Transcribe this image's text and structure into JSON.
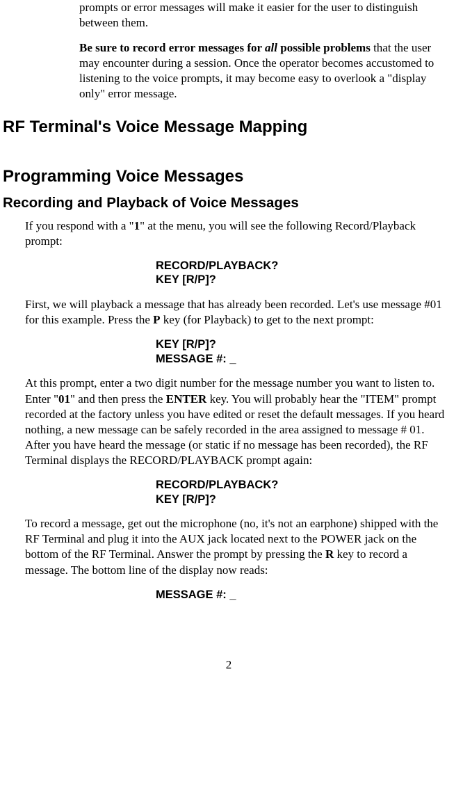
{
  "para1": "prompts or error messages will make it easier for the user to distinguish between them.",
  "para2_start": "Be sure to record error messages for ",
  "para2_all": "all",
  "para2_mid": " possible problems",
  "para2_end": " that the user may encounter during a session. Once the operator becomes accustomed to listening to the voice prompts, it may become easy to overlook a \"display only\" error message.",
  "h1a": "RF Terminal's Voice Message Mapping",
  "h1b": "Programming Voice Messages",
  "h2a": "Recording and Playback of Voice Messages",
  "para3_start": "If you respond with a \"",
  "para3_one": "1",
  "para3_end": "\" at the menu, you will see the following Record/Playback prompt:",
  "prompt1_line1": "RECORD/PLAYBACK?",
  "prompt1_line2": "KEY [R/P]?",
  "para4_start": "First, we will playback a message that has already been recorded. Let's use message #01 for this example. Press the ",
  "para4_p": "P",
  "para4_end": " key (for Playback) to get to the next prompt:",
  "prompt2_line1": "KEY [R/P]?",
  "prompt2_line2": "MESSAGE #: _",
  "para5_start": "At this prompt, enter a two digit number for the message number you want to listen to.  Enter \"",
  "para5_01": "01",
  "para5_mid1": "\" and then press the ",
  "para5_enter": "ENTER",
  "para5_end": " key. You will probably hear the \"ITEM\" prompt recorded at the factory unless you have edited or reset the default messages. If you heard nothing, a new message can be safely recorded in the area assigned to message # 01. After you have heard the message (or static if no message has been recorded), the RF Terminal displays the RECORD/PLAYBACK prompt again:",
  "prompt3_line1": "RECORD/PLAYBACK?",
  "prompt3_line2": "KEY [R/P]?",
  "para6_start": "To record a message, get out the microphone (no, it's not an earphone) shipped with the RF Terminal and plug it into the AUX jack located next to the POWER jack on the bottom of the RF Terminal. Answer the prompt by pressing the ",
  "para6_r": "R",
  "para6_end": " key to record a message. The bottom line of the display now reads:",
  "prompt4": "MESSAGE  #: _",
  "page_number": "2"
}
